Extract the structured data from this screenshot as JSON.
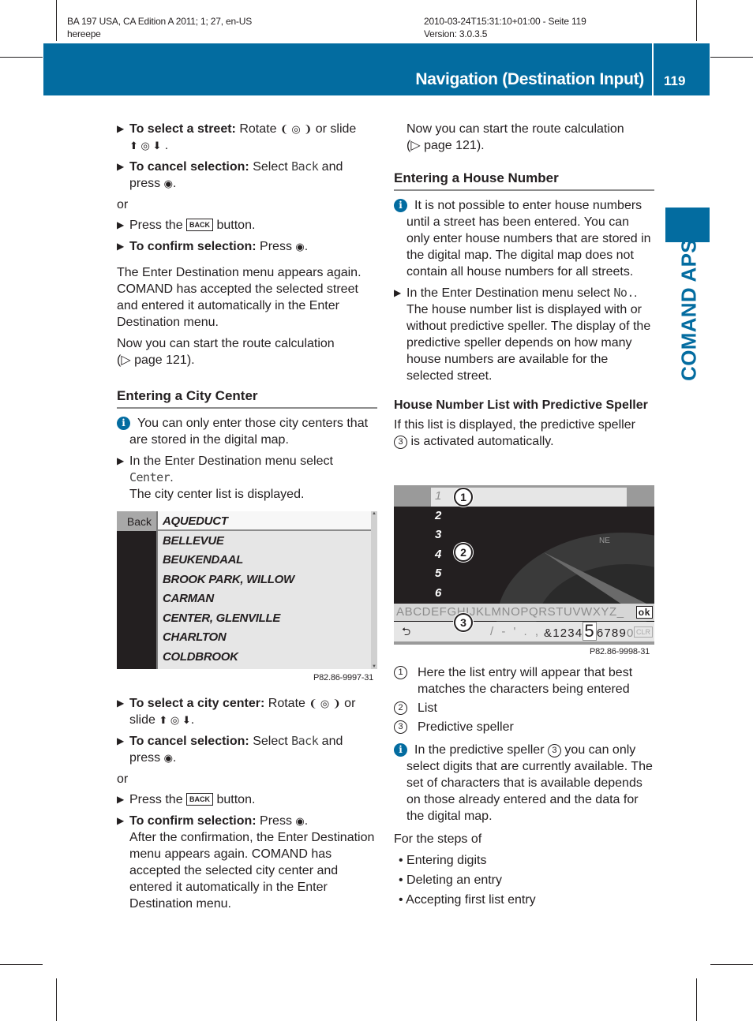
{
  "meta": {
    "doc_line1": "BA 197 USA, CA Edition A 2011; 1; 27, en-US",
    "doc_line2": "hereepe",
    "stamp_line1": "2010-03-24T15:31:10+01:00 - Seite 119",
    "stamp_line2": "Version: 3.0.3.5"
  },
  "header": {
    "title": "Navigation (Destination Input)",
    "page_number": "119",
    "accent_color": "#036ca0"
  },
  "side_tab": {
    "label": "COMAND APS"
  },
  "left": {
    "step_street_bold": "To select a street:",
    "step_street_text": " Rotate ",
    "step_street_or": " or slide",
    "cancel_bold": "To cancel selection:",
    "cancel_text": " Select ",
    "cancel_mono": "Back",
    "cancel_and": " and",
    "press": "press",
    "or": "or",
    "press_the": "Press the ",
    "back_key": "BACK",
    "button_text": " button.",
    "confirm_bold": "To confirm selection:",
    "confirm_text": " Press ",
    "para_street_accepted": "The Enter Destination menu appears again. COMAND has accepted the selected street and entered it automatically in the Enter Destination menu.",
    "para_route_1": "Now you can start the route calculation",
    "para_route_2": "(▷ page 121).",
    "heading_city": "Entering a City Center",
    "info_city": "You can only enter those city centers that are stored in the digital map.",
    "step_select_center_text": "In the Enter Destination menu select",
    "step_select_center_mono": "Center",
    "step_select_center_result": "The city center list is displayed.",
    "city_screen": {
      "back_label": "Back",
      "items": [
        "AQUEDUCT",
        "BELLEVUE",
        "BEUKENDAAL",
        "BROOK PARK, WILLOW",
        "CARMAN",
        "CENTER, GLENVILLE",
        "CHARLTON",
        "COLDBROOK"
      ],
      "selected_index": 0,
      "caption": "P82.86-9997-31"
    },
    "step_city_bold": "To select a city center:",
    "step_city_text": " Rotate ",
    "step_city_or": " or",
    "slide": "slide",
    "confirm_result": "After the confirmation, the Enter Destination menu appears again. COMAND has accepted the selected city center and entered it automatically in the Enter Destination menu."
  },
  "right": {
    "para_route_1": "Now you can start the route calculation",
    "para_route_2": "(▷ page 121).",
    "heading_house": "Entering a House Number",
    "info_house": "It is not possible to enter house numbers until a street has been entered. You can only enter house numbers that are stored in the digital map. The digital map does not contain all house numbers for all streets.",
    "step_no_text": "In the Enter Destination menu select",
    "step_no_mono": "No.",
    "step_no_result": "The house number list is displayed with or without predictive speller. The display of the predictive speller depends on how many house numbers are available for the selected street.",
    "subheading": "House Number List with Predictive Speller",
    "para_speller_1": "If this list is displayed, the predictive speller",
    "para_speller_2": " is activated automatically.",
    "house_screen": {
      "numbers": [
        "1",
        "2",
        "3",
        "4",
        "5",
        "6"
      ],
      "letters": "ABCDEFGHIJKLMNOPQRSTUVWXYZ_",
      "ok_label": "ok",
      "symbols": "/ - ' . ,",
      "digits_before": "&1234",
      "digit_selected": "5",
      "digits_after": "6789",
      "digit_dim": "0",
      "clr_label": "CLR",
      "compass_label": "NE",
      "callouts": [
        "1",
        "2",
        "3"
      ],
      "caption": "P82.86-9998-31"
    },
    "legend": [
      {
        "num": "1",
        "text": "Here the list entry will appear that best matches the characters being entered"
      },
      {
        "num": "2",
        "text": "List"
      },
      {
        "num": "3",
        "text": "Predictive speller"
      }
    ],
    "info_speller_1": "In the predictive speller",
    "info_speller_2": " you can only select digits that are currently available. The set of characters that is available depends on those already entered and the data for the digital map.",
    "steps_intro": "For the steps of",
    "bullets": [
      "Entering digits",
      "Deleting an entry",
      "Accepting first list entry"
    ]
  }
}
